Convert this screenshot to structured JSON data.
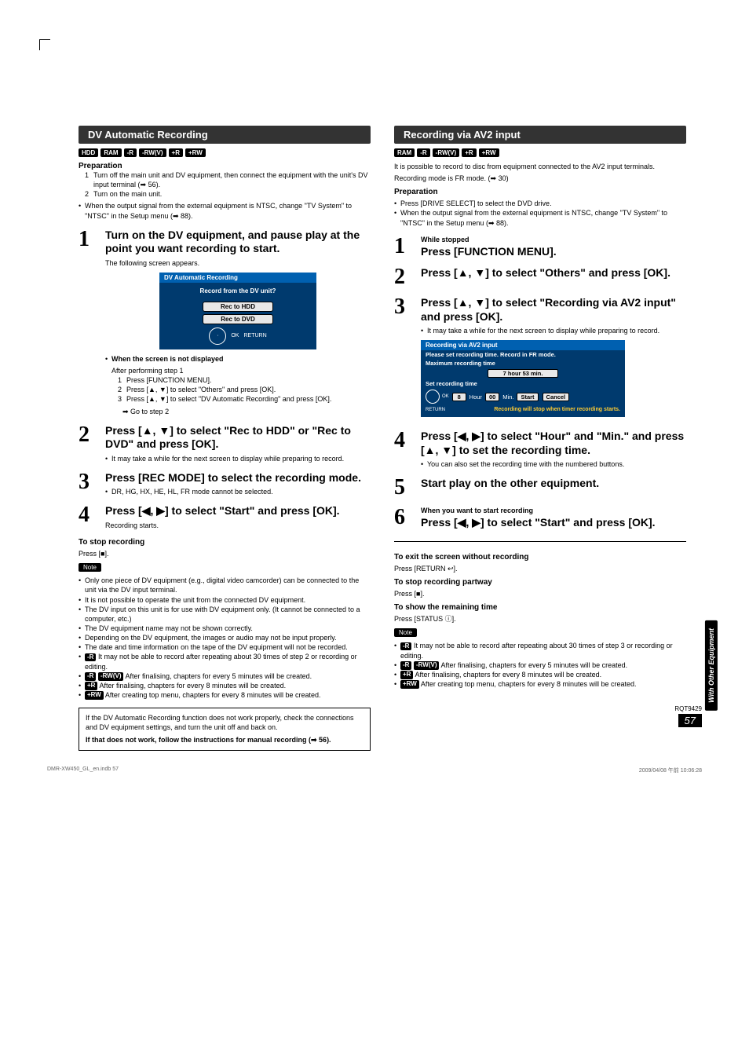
{
  "left": {
    "header": "DV Automatic Recording",
    "tags": [
      "HDD",
      "RAM",
      "-R",
      "-RW(V)",
      "+R",
      "+RW"
    ],
    "prep_title": "Preparation",
    "prep_items": [
      "Turn off the main unit and DV equipment, then connect the equipment with the unit's DV input terminal (➡ 56).",
      "Turn on the main unit."
    ],
    "prep_bullet": "When the output signal from the external equipment is NTSC, change \"TV System\" to \"NTSC\" in the Setup menu (➡ 88).",
    "step1": {
      "title": "Turn on the DV equipment, and pause play at the point you want recording to start.",
      "after": "The following screen appears.",
      "screen": {
        "title": "DV Automatic Recording",
        "question": "Record from the DV unit?",
        "btn1": "Rec to HDD",
        "btn2": "Rec to DVD",
        "ok": "OK",
        "return": "RETURN"
      },
      "notdisp_head": "When the screen is not displayed",
      "notdisp_line": "After performing step 1",
      "notdisp_1": "Press [FUNCTION MENU].",
      "notdisp_2": "Press [▲, ▼] to select \"Others\" and press [OK].",
      "notdisp_3": "Press [▲, ▼] to select \"DV Automatic Recording\" and press [OK].",
      "notdisp_go": "➡ Go to step 2"
    },
    "step2": {
      "title": "Press [▲, ▼] to select \"Rec to HDD\" or \"Rec to DVD\" and press [OK].",
      "bullet": "It may take a while for the next screen to display while preparing to record."
    },
    "step3": {
      "title": "Press [REC MODE] to select the recording mode.",
      "bullet": "DR, HG, HX, HE, HL, FR mode cannot be selected."
    },
    "step4": {
      "title": "Press [◀, ▶] to select \"Start\" and press [OK].",
      "after": "Recording starts."
    },
    "stop_title": "To stop recording",
    "stop_text": "Press [■].",
    "note_label": "Note",
    "notes": [
      "Only one piece of DV equipment (e.g., digital video camcorder) can be connected to the unit via the DV input terminal.",
      "It is not possible to operate the unit from the connected DV equipment.",
      "The DV input on this unit is for use with DV equipment only. (It cannot be connected to a computer, etc.)",
      "The DV equipment name may not be shown correctly.",
      "Depending on the DV equipment, the images or audio may not be input properly.",
      "The date and time information on the tape of the DV equipment will not be recorded."
    ],
    "tagged_notes": [
      {
        "tags": [
          "-R"
        ],
        "text": "It may not be able to record after repeating about 30 times of step 2 or recording or editing."
      },
      {
        "tags": [
          "-R",
          "-RW(V)"
        ],
        "text": "After finalising, chapters for every 5 minutes will be created."
      },
      {
        "tags": [
          "+R"
        ],
        "text": "After finalising, chapters for every 8 minutes will be created."
      },
      {
        "tags": [
          "+RW"
        ],
        "text": "After creating top menu, chapters for every 8 minutes will be created."
      }
    ],
    "box_line1": "If the DV Automatic Recording function does not work properly, check the connections and DV equipment settings, and turn the unit off and back on.",
    "box_line2": "If that does not work, follow the instructions for manual recording (➡ 56)."
  },
  "right": {
    "header": "Recording via AV2 input",
    "tags": [
      "RAM",
      "-R",
      "-RW(V)",
      "+R",
      "+RW"
    ],
    "intro": "It is possible to record to disc from equipment connected to the AV2 input terminals.",
    "mode": "Recording mode is FR mode. (➡ 30)",
    "prep_title": "Preparation",
    "prep_bullets": [
      "Press [DRIVE SELECT] to select the DVD drive.",
      "When the output signal from the external equipment is NTSC, change \"TV System\" to \"NTSC\" in the Setup menu (➡ 88)."
    ],
    "step1": {
      "sub": "While stopped",
      "title": "Press [FUNCTION MENU]."
    },
    "step2": {
      "title": "Press [▲, ▼] to select \"Others\" and press [OK]."
    },
    "step3": {
      "title": "Press [▲, ▼] to select \"Recording via AV2 input\" and press [OK].",
      "bullet": "It may take a while for the next screen to display while preparing to record.",
      "screen": {
        "title": "Recording via AV2 input",
        "l1": "Please set recording time. Record in FR mode.",
        "l2": "Maximum recording time",
        "max": "7 hour 53 min.",
        "l3": "Set recording time",
        "hourVal": "8",
        "hour": "Hour",
        "minVal": "00",
        "min": "Min.",
        "start": "Start",
        "cancel": "Cancel",
        "warn": "Recording will stop when timer recording starts.",
        "ok": "OK",
        "return": "RETURN"
      }
    },
    "step4": {
      "title": "Press [◀, ▶] to select \"Hour\" and \"Min.\" and press [▲, ▼] to set the recording time.",
      "bullet": "You can also set the recording time with the numbered buttons."
    },
    "step5": {
      "title": "Start play on the other equipment."
    },
    "step6": {
      "sub": "When you want to start recording",
      "title": "Press [◀, ▶] to select \"Start\" and press [OK]."
    },
    "exit_t": "To exit the screen without recording",
    "exit_v": "Press [RETURN ↩].",
    "stop_t": "To stop recording partway",
    "stop_v": "Press [■].",
    "show_t": "To show the remaining time",
    "show_v": "Press [STATUS ⓘ].",
    "note_label": "Note",
    "tagged_notes": [
      {
        "tags": [
          "-R"
        ],
        "text": "It may not be able to record after repeating about 30 times of step 3 or recording or editing."
      },
      {
        "tags": [
          "-R",
          "-RW(V)"
        ],
        "text": "After finalising, chapters for every 5 minutes will be created."
      },
      {
        "tags": [
          "+R"
        ],
        "text": "After finalising, chapters for every 8 minutes will be created."
      },
      {
        "tags": [
          "+RW"
        ],
        "text": "After creating top menu, chapters for every 8 minutes will be created."
      }
    ]
  },
  "sidebar": "With Other Equipment",
  "footer_code": "RQT9429",
  "page_number": "57",
  "bottom_file": "DMR-XW450_GL_en.indb   57",
  "bottom_date": "2009/04/08   午前 10:06:28"
}
